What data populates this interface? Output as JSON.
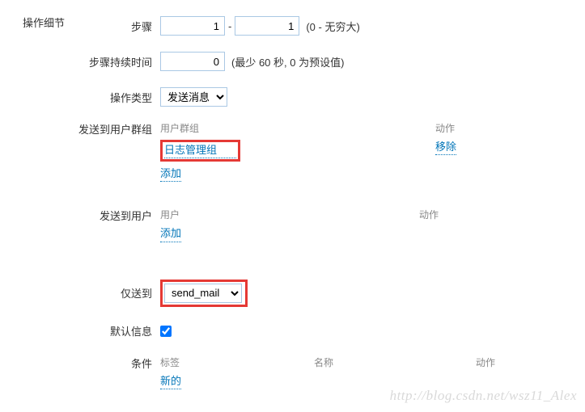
{
  "sectionTitle": "操作细节",
  "rows": {
    "step": {
      "label": "步骤",
      "from": "1",
      "to": "1",
      "hint": "(0 - 无穷大)"
    },
    "duration": {
      "label": "步骤持续时间",
      "value": "0",
      "hint": "(最少 60 秒, 0 为预设值)"
    },
    "opType": {
      "label": "操作类型",
      "selected": "发送消息"
    },
    "sendGroup": {
      "label": "发送到用户群组",
      "header1": "用户群组",
      "header2": "动作",
      "item": "日志管理组",
      "remove": "移除",
      "add": "添加"
    },
    "sendUser": {
      "label": "发送到用户",
      "header1": "用户",
      "header2": "动作",
      "add": "添加"
    },
    "onlyTo": {
      "label": "仅送到",
      "selected": "send_mail"
    },
    "defaultInfo": {
      "label": "默认信息"
    },
    "condition": {
      "label": "条件",
      "h1": "标签",
      "h2": "名称",
      "h3": "动作",
      "new": "新的"
    }
  },
  "watermark": "http://blog.csdn.net/wsz11_Alex"
}
